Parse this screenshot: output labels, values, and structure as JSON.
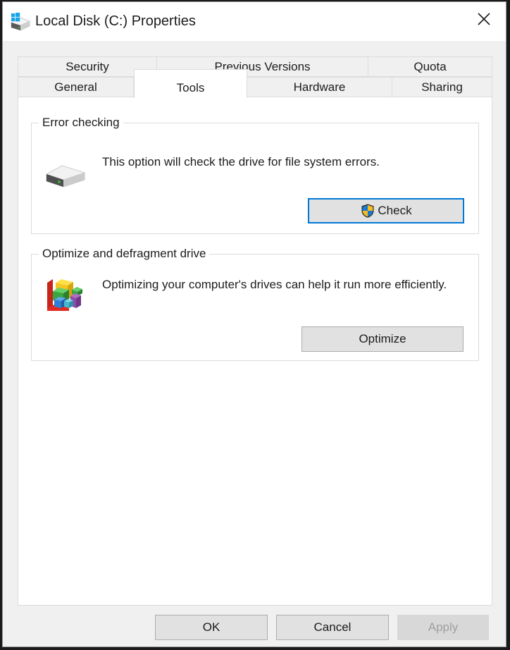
{
  "window": {
    "title": "Local Disk (C:) Properties",
    "icon": "local-disk-drive-icon",
    "close_label": "✕",
    "accent_color": "#0078d7",
    "dialog_bg": "#f0f0f0",
    "panel_bg": "#ffffff"
  },
  "tabs": {
    "row1": [
      {
        "label": "Security",
        "selected": false
      },
      {
        "label": "Previous Versions",
        "selected": false
      },
      {
        "label": "Quota",
        "selected": false
      }
    ],
    "row2": [
      {
        "label": "General",
        "selected": false
      },
      {
        "label": "Tools",
        "selected": true
      },
      {
        "label": "Hardware",
        "selected": false
      },
      {
        "label": "Sharing",
        "selected": false
      }
    ],
    "selected": "Tools"
  },
  "groups": [
    {
      "id": "error-checking",
      "legend": "Error checking",
      "description": "This option will check the drive for file system errors.",
      "icon": "hard-drive-icon",
      "button": {
        "label": "Check",
        "has_shield": true,
        "focused": true,
        "enabled": true
      }
    },
    {
      "id": "optimize-defragment",
      "legend": "Optimize and defragment drive",
      "description": "Optimizing your computer's drives can help it run more efficiently.",
      "icon": "defragment-blocks-icon",
      "button": {
        "label": "Optimize",
        "has_shield": false,
        "focused": false,
        "enabled": true
      }
    }
  ],
  "footer": {
    "ok_label": "OK",
    "cancel_label": "Cancel",
    "apply_label": "Apply",
    "apply_enabled": false
  }
}
